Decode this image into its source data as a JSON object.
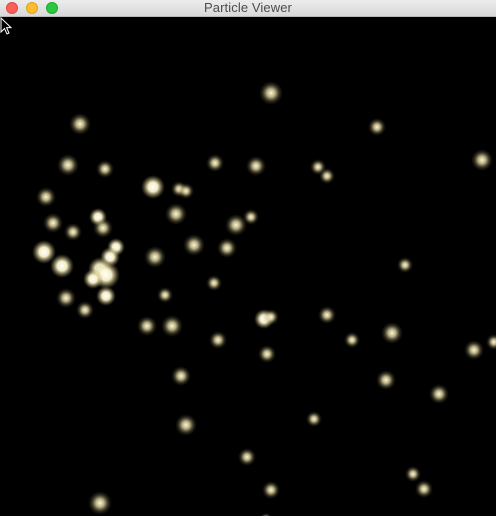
{
  "window": {
    "title": "Particle Viewer",
    "buttons": {
      "close": "close",
      "minimize": "minimize",
      "zoom": "zoom"
    }
  },
  "particles_view": {
    "background": "#000000",
    "particle_color": "#f6ebb8",
    "cursor_icon": "arrow-cursor-icon"
  }
}
